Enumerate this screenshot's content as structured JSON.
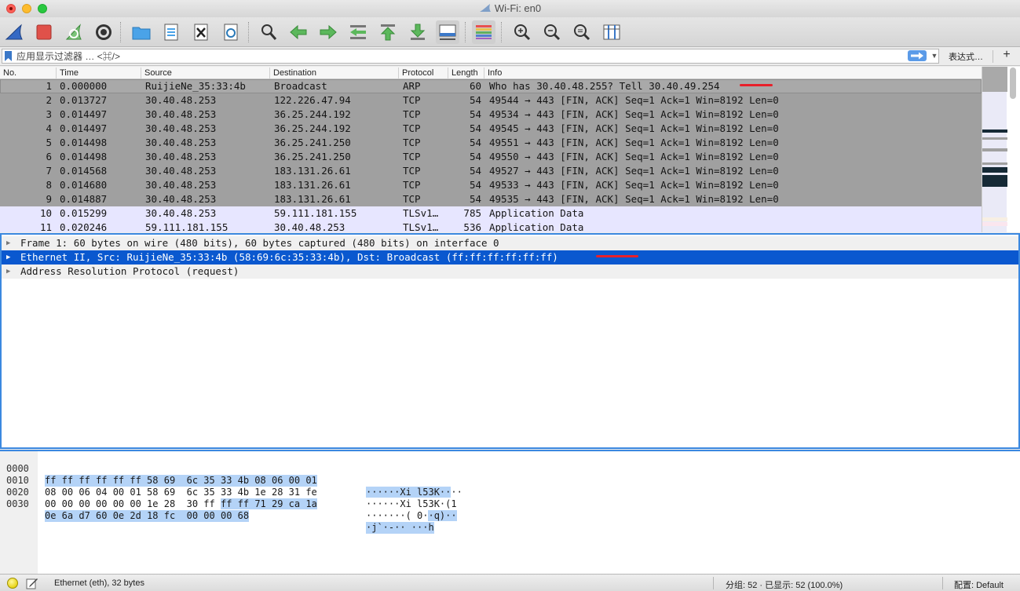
{
  "window": {
    "title": "Wi-Fi: en0"
  },
  "toolbar": {
    "buttons": [
      "start-capture-icon",
      "stop-capture-icon",
      "restart-capture-icon",
      "capture-options-icon",
      "open-file-icon",
      "save-file-icon",
      "close-file-icon",
      "reload-file-icon",
      "find-packet-icon",
      "go-back-icon",
      "go-forward-icon",
      "go-to-packet-icon",
      "go-first-icon",
      "go-last-icon",
      "auto-scroll-icon",
      "colorize-icon",
      "zoom-in-icon",
      "zoom-out-icon",
      "zoom-normal-icon",
      "resize-columns-icon"
    ]
  },
  "filter": {
    "placeholder": "应用显示过滤器 … <⌘/>",
    "expressions_label": "表达式…",
    "add_label": "+"
  },
  "packet_list": {
    "columns": {
      "no": "No.",
      "time": "Time",
      "source": "Source",
      "destination": "Destination",
      "protocol": "Protocol",
      "length": "Length",
      "info": "Info"
    },
    "rows": [
      {
        "no": "1",
        "time": "0.000000",
        "source": "RuijieNe_35:33:4b",
        "destination": "Broadcast",
        "protocol": "ARP",
        "length": "60",
        "info": "Who has 30.40.48.255? Tell 30.40.49.254"
      },
      {
        "no": "2",
        "time": "0.013727",
        "source": "30.40.48.253",
        "destination": "122.226.47.94",
        "protocol": "TCP",
        "length": "54",
        "info": "49544 → 443 [FIN, ACK] Seq=1 Ack=1 Win=8192 Len=0"
      },
      {
        "no": "3",
        "time": "0.014497",
        "source": "30.40.48.253",
        "destination": "36.25.244.192",
        "protocol": "TCP",
        "length": "54",
        "info": "49534 → 443 [FIN, ACK] Seq=1 Ack=1 Win=8192 Len=0"
      },
      {
        "no": "4",
        "time": "0.014497",
        "source": "30.40.48.253",
        "destination": "36.25.244.192",
        "protocol": "TCP",
        "length": "54",
        "info": "49545 → 443 [FIN, ACK] Seq=1 Ack=1 Win=8192 Len=0"
      },
      {
        "no": "5",
        "time": "0.014498",
        "source": "30.40.48.253",
        "destination": "36.25.241.250",
        "protocol": "TCP",
        "length": "54",
        "info": "49551 → 443 [FIN, ACK] Seq=1 Ack=1 Win=8192 Len=0"
      },
      {
        "no": "6",
        "time": "0.014498",
        "source": "30.40.48.253",
        "destination": "36.25.241.250",
        "protocol": "TCP",
        "length": "54",
        "info": "49550 → 443 [FIN, ACK] Seq=1 Ack=1 Win=8192 Len=0"
      },
      {
        "no": "7",
        "time": "0.014568",
        "source": "30.40.48.253",
        "destination": "183.131.26.61",
        "protocol": "TCP",
        "length": "54",
        "info": "49527 → 443 [FIN, ACK] Seq=1 Ack=1 Win=8192 Len=0"
      },
      {
        "no": "8",
        "time": "0.014680",
        "source": "30.40.48.253",
        "destination": "183.131.26.61",
        "protocol": "TCP",
        "length": "54",
        "info": "49533 → 443 [FIN, ACK] Seq=1 Ack=1 Win=8192 Len=0"
      },
      {
        "no": "9",
        "time": "0.014887",
        "source": "30.40.48.253",
        "destination": "183.131.26.61",
        "protocol": "TCP",
        "length": "54",
        "info": "49535 → 443 [FIN, ACK] Seq=1 Ack=1 Win=8192 Len=0"
      },
      {
        "no": "10",
        "time": "0.015299",
        "source": "30.40.48.253",
        "destination": "59.111.181.155",
        "protocol": "TLSv1…",
        "length": "785",
        "info": "Application Data"
      },
      {
        "no": "11",
        "time": "0.020246",
        "source": "59.111.181.155",
        "destination": "30.40.48.253",
        "protocol": "TLSv1…",
        "length": "536",
        "info": "Application Data"
      }
    ],
    "colors": {
      "arp_selected": "#a9a9a9",
      "tcp_fin": "#a0a0a0",
      "tls": "#e7e6ff",
      "annotation": "#e8202a"
    }
  },
  "details": {
    "rows": [
      {
        "text": "Frame 1: 60 bytes on wire (480 bits), 60 bytes captured (480 bits) on interface 0",
        "expander": "▶"
      },
      {
        "text": "Ethernet II, Src: RuijieNe_35:33:4b (58:69:6c:35:33:4b), Dst: Broadcast (ff:ff:ff:ff:ff:ff)",
        "expander": "▶"
      },
      {
        "text": "Address Resolution Protocol (request)",
        "expander": "▶"
      }
    ],
    "selected_color": "#0a58cf"
  },
  "bytes": {
    "rows": [
      {
        "offset": "0000",
        "hex_a": "ff ff ff ff ff ff 58 69  6c 35 33 4b 08 06 00 01",
        "hex_b": "",
        "hex_c": "",
        "ascii_a": "······Xi l53K··",
        "ascii_b": "··"
      },
      {
        "offset": "0010",
        "hex_a": "",
        "hex_b": "08 00 06 04 00 01 58 69  6c 35 33 4b 1e 28 31 fe",
        "hex_c": "",
        "ascii_a": "",
        "ascii_b": "······Xi l53K·(1"
      },
      {
        "offset": "0020",
        "hex_a": "00 00 00 00 00 00 1e 28  30 ff ",
        "hex_b": "ff ff 71 29 ca 1a",
        "hex_c": "",
        "ascii_a": "·······( 0·",
        "ascii_b": "·q)··"
      },
      {
        "offset": "0030",
        "hex_a": "",
        "hex_b": "0e 6a d7 60 0e 2d 18 fc  00 00 00 68",
        "hex_c": "",
        "ascii_a": "",
        "ascii_b": "·j`·-·· ···h"
      }
    ]
  },
  "status": {
    "left_text": "Ethernet (eth), 32 bytes",
    "packet_counts": "分组: 52 · 已显示: 52 (100.0%)",
    "profile": "配置: Default"
  }
}
